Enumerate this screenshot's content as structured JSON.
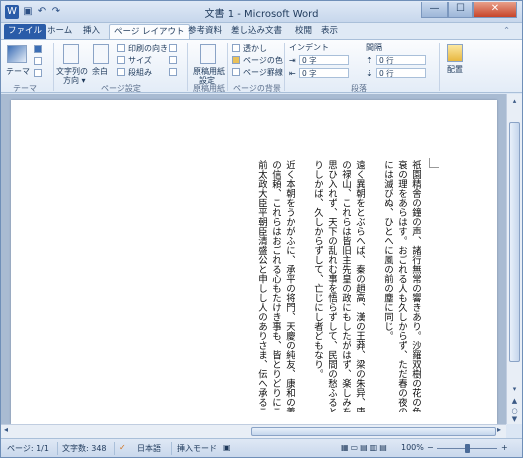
{
  "window": {
    "title": "文書 1 - Microsoft Word",
    "min": "—",
    "max": "☐",
    "close": "✕"
  },
  "qat": {
    "word_icon": "W",
    "save": "▣",
    "undo": "↶",
    "redo": "↷"
  },
  "tabs": [
    {
      "label": "ファイル"
    },
    {
      "label": "ホーム"
    },
    {
      "label": "挿入"
    },
    {
      "label": "ページ レイアウト"
    },
    {
      "label": "参考資料"
    },
    {
      "label": "差し込み文書"
    },
    {
      "label": "校閲"
    },
    {
      "label": "表示"
    }
  ],
  "ribbon": {
    "theme": {
      "label": "テーマ",
      "group": "テーマ"
    },
    "page_setup": {
      "text_direction": "文字列の\n方向",
      "margins": "余白",
      "orientation": "印刷の向き",
      "size": "サイズ",
      "columns": "段組み",
      "group": "ページ設定"
    },
    "genko": {
      "label": "原稿用紙\n設定",
      "group": "原稿用紙"
    },
    "page_bg": {
      "watermark": "透かし",
      "page_color": "ページの色",
      "page_border": "ページ罫線",
      "group": "ページの背景"
    },
    "indent": {
      "title": "インデント",
      "left": "0 字",
      "right": "0 字"
    },
    "spacing": {
      "title": "間隔",
      "before": "0 行",
      "after": "0 行"
    },
    "paragraph_group": "段落",
    "arrange": {
      "label": "配置"
    }
  },
  "document": {
    "columns": [
      "祇園精舎の鐘の声、諸行無常の響きあり。沙羅双樹の花の色、盛者必",
      "衰の理をあらはす。おごれる人も久しからず、ただ春の夜の夢のごとし。たけき者もつひ",
      "には滅びぬ、ひとへに風の前の塵に同じ。",
      "",
      "遠く異朝をとぶらへば、秦の趙高、漢の王莽、梁の朱异、唐",
      "の禄山、これらは皆旧主先皇の政にもしたがはず、楽しみをきはめ、諌めをも",
      "思ひ入れず、天下の乱れむ事を悟らずして、民間の愁ふるところを知らざ",
      "りしかば、久しからずして、亡じにし者どもなり。",
      "",
      "近く本朝をうかがふに、承平の将門、天慶の純友、康和の義親、平治",
      "の信頼、これらはおごれる心もたけき事も、皆とりどりにこそありしかども、まぢかくは六波羅の入道",
      "前太政大臣平朝臣清盛公と申しし人のありさま、伝へ承るこそ心も詞も及ばれね。"
    ]
  },
  "status": {
    "page": "ページ: 1/1",
    "words": "文字数: 348",
    "proof_icon": "✓",
    "language": "日本語",
    "insert_mode": "挿入モード",
    "zoom": "100%",
    "zoom_level": 0.5,
    "zoom_out": "−",
    "zoom_in": "+"
  },
  "colors": {
    "accent": "#2a5ca8",
    "ribbon_bg": "#fbfcfe",
    "frame": "#dbe6f4"
  }
}
